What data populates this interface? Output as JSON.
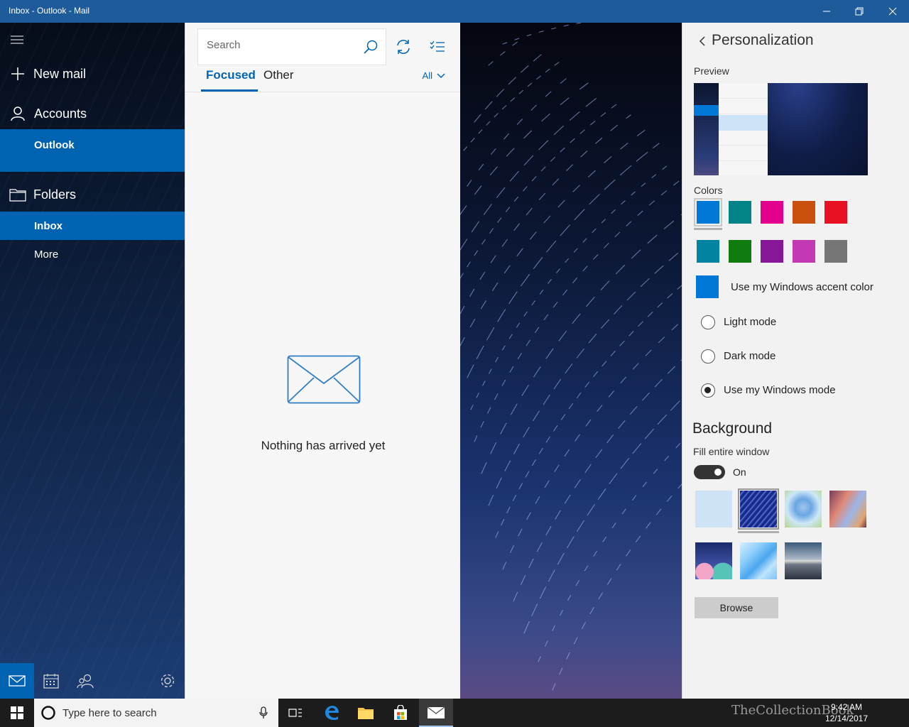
{
  "window": {
    "title": "Inbox - Outlook - Mail",
    "minimize_icon": "minimize-icon",
    "restore_icon": "restore-icon",
    "close_icon": "close-icon"
  },
  "nav": {
    "menu_icon": "hamburger-icon",
    "new_mail": "New mail",
    "accounts": "Accounts",
    "account_name": "Outlook",
    "folders": "Folders",
    "inbox": "Inbox",
    "more": "More",
    "bottom": [
      "mail-icon",
      "calendar-icon",
      "people-icon",
      "settings-icon"
    ]
  },
  "list": {
    "search_placeholder": "Search",
    "tabs": [
      "Focused",
      "Other"
    ],
    "filter": "All",
    "empty_message": "Nothing has arrived yet"
  },
  "personalization": {
    "title": "Personalization",
    "preview_label": "Preview",
    "colors_label": "Colors",
    "colors": [
      "#0078d7",
      "#038387",
      "#e3008c",
      "#ca5010",
      "#e81123",
      "#0084a0",
      "#107c10",
      "#881798",
      "#c239b3",
      "#767676"
    ],
    "selected_color": "#0078d7",
    "accent_label": "Use my Windows accent color",
    "accent_color": "#0078d7",
    "modes": [
      "Light mode",
      "Dark mode",
      "Use my Windows mode"
    ],
    "selected_mode": "Use my Windows mode",
    "background_heading": "Background",
    "fill_label": "Fill entire window",
    "fill_toggle": "On",
    "browse_label": "Browse"
  },
  "taskbar": {
    "search_placeholder": "Type here to search",
    "time": "9:42 AM",
    "date": "12/14/2017",
    "watermark": "TheCollectionBook"
  }
}
